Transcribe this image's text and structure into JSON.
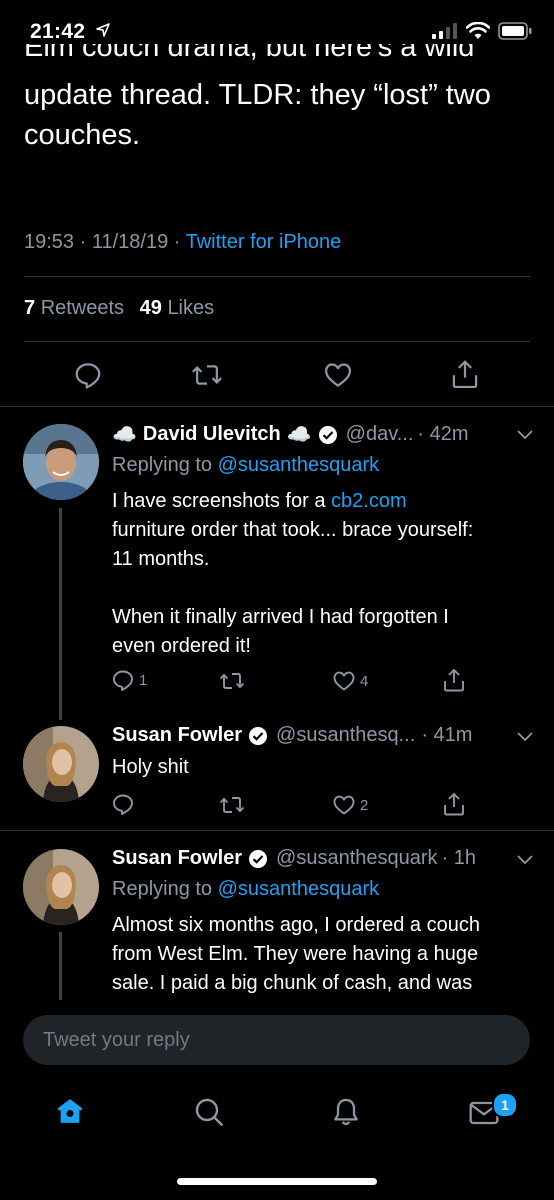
{
  "status_bar": {
    "time": "21:42"
  },
  "main_tweet": {
    "text_partial_top": "Elm couch drama, but here's a wild",
    "text_line_2": "update thread. TLDR: they “lost” two",
    "text_line_3": "couches.",
    "timestamp": "19:53 · 11/18/19 · ",
    "source": "Twitter for iPhone",
    "retweets_count": "7",
    "retweets_label": "Retweets",
    "likes_count": "49",
    "likes_label": "Likes"
  },
  "replies": [
    {
      "name": "David Ulevitch",
      "name_prefix_emoji": "☁️",
      "name_suffix_emoji": "☁️",
      "handle": "@dav...",
      "time": "· 42m",
      "replying_label": "Replying to ",
      "replying_to": "@susanthesquark",
      "line_1_pre": "I have screenshots for a ",
      "line_1_link": "cb2.com",
      "line_2": "furniture order that took... brace yourself:",
      "line_3": "11 months.",
      "line_4": "When it finally arrived I had forgotten I",
      "line_5": "even ordered it!",
      "reply_count": "1",
      "retweet_count": "",
      "like_count": "4"
    },
    {
      "name": "Susan Fowler",
      "handle": "@susanthesq...",
      "time": "· 41m",
      "line_1": "Holy shit",
      "reply_count": "",
      "retweet_count": "",
      "like_count": "2"
    },
    {
      "name": "Susan Fowler",
      "handle": "@susanthesquark",
      "time": "· 1h",
      "replying_label": "Replying to ",
      "replying_to": "@susanthesquark",
      "line_1": "Almost six months ago, I ordered a couch",
      "line_2": "from West Elm. They were having a huge",
      "line_3": "sale. I paid a big chunk of cash, and was"
    }
  ],
  "reply_box": {
    "placeholder": "Tweet your reply"
  },
  "tabbar": {
    "messages_badge": "1"
  },
  "colors": {
    "accent": "#1da1f2",
    "muted": "#8b98a5",
    "background": "#000000"
  },
  "icons": [
    "location-arrow-icon",
    "signal-icon",
    "wifi-icon",
    "battery-icon",
    "reply-icon",
    "retweet-icon",
    "like-icon",
    "share-icon",
    "verified-icon",
    "chevron-down-icon",
    "home-icon",
    "search-icon",
    "notifications-icon",
    "messages-icon"
  ]
}
